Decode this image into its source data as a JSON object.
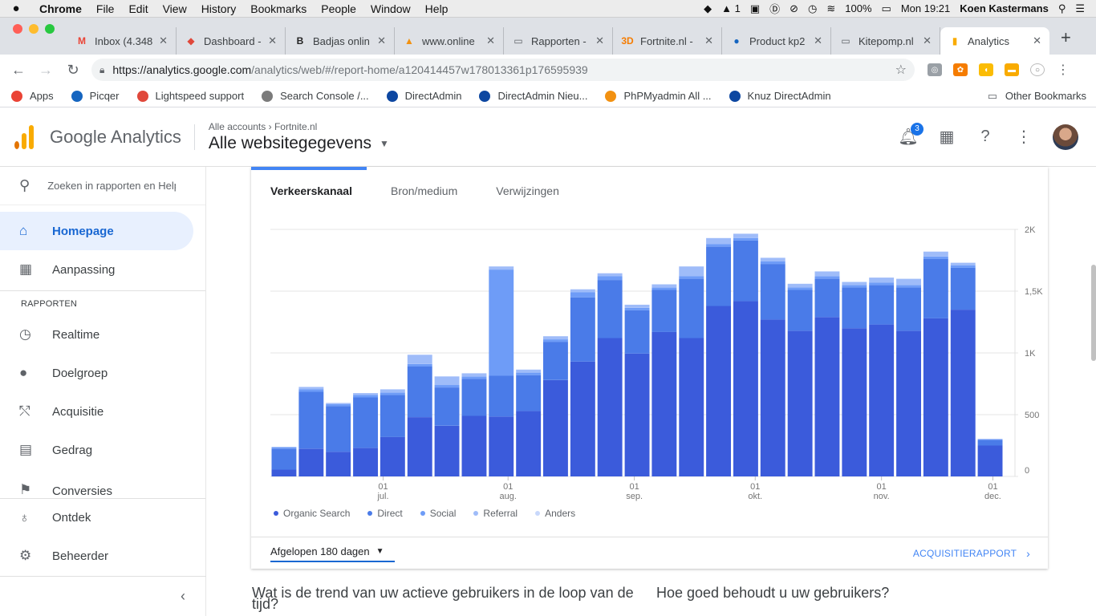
{
  "menubar": {
    "apple_icon": "apple-logo-icon",
    "app": "Chrome",
    "menus": [
      "File",
      "Edit",
      "View",
      "History",
      "Bookmarks",
      "People",
      "Window",
      "Help"
    ],
    "status_badge": "1",
    "battery": "100%",
    "clock": "Mon 19:21",
    "user": "Koen Kastermans"
  },
  "tabs": [
    {
      "label": "Inbox (4.348",
      "icon": "gmail-icon",
      "color": "#ea4335",
      "glyph": "M"
    },
    {
      "label": "Dashboard -",
      "icon": "lightspeed-icon",
      "color": "#e0483b",
      "glyph": "◆"
    },
    {
      "label": "Badjas onlin",
      "icon": "b-icon",
      "color": "#222222",
      "glyph": "B"
    },
    {
      "label": "www.online",
      "icon": "pma-icon",
      "color": "#f29111",
      "glyph": "▲"
    },
    {
      "label": "Rapporten -",
      "icon": "page-icon",
      "color": "#5f6368",
      "glyph": "▭"
    },
    {
      "label": "Fortnite.nl -",
      "icon": "fortnite-icon",
      "color": "#f57c00",
      "glyph": "3D"
    },
    {
      "label": "Product kp2",
      "icon": "picqer-icon",
      "color": "#1565c0",
      "glyph": "●"
    },
    {
      "label": "Kitepomp.nl",
      "icon": "page-icon",
      "color": "#5f6368",
      "glyph": "▭"
    },
    {
      "label": "Analytics",
      "icon": "analytics-icon",
      "color": "#f9ab00",
      "glyph": "▮"
    }
  ],
  "address": {
    "host": "https://analytics.google.com",
    "path": "/analytics/web/#/report-home/a120414457w178013361p176595939"
  },
  "bookmarks": [
    {
      "label": "Apps",
      "icon": "apps-grid-icon",
      "color": "#ea4335"
    },
    {
      "label": "Picqer",
      "icon": "picqer-icon",
      "color": "#1565c0"
    },
    {
      "label": "Lightspeed support",
      "icon": "lightspeed-icon",
      "color": "#e0483b"
    },
    {
      "label": "Search Console /...",
      "icon": "search-console-icon",
      "color": "#7b7b7b"
    },
    {
      "label": "DirectAdmin",
      "icon": "directadmin-icon",
      "color": "#0d47a1"
    },
    {
      "label": "DirectAdmin Nieu...",
      "icon": "directadmin-icon",
      "color": "#0d47a1"
    },
    {
      "label": "PhPMyadmin All ...",
      "icon": "pma-icon",
      "color": "#f29111"
    },
    {
      "label": "Knuz DirectAdmin",
      "icon": "directadmin-icon",
      "color": "#0d47a1"
    }
  ],
  "other_bookmarks": "Other Bookmarks",
  "ga": {
    "product": "Google Analytics",
    "crumb_accounts": "Alle accounts",
    "crumb_sep": "›",
    "crumb_property": "Fortnite.nl",
    "view": "Alle websitegegevens",
    "notifications": "3"
  },
  "sidebar": {
    "search_placeholder": "Zoeken in rapporten en Help",
    "section": "RAPPORTEN",
    "items": [
      {
        "label": "Homepage",
        "icon": "home-icon",
        "active": true
      },
      {
        "label": "Aanpassing",
        "icon": "customization-icon"
      },
      {
        "label": "Realtime",
        "icon": "clock-icon"
      },
      {
        "label": "Doelgroep",
        "icon": "person-icon"
      },
      {
        "label": "Acquisitie",
        "icon": "acquisition-icon"
      },
      {
        "label": "Gedrag",
        "icon": "behavior-icon"
      },
      {
        "label": "Conversies",
        "icon": "flag-icon"
      },
      {
        "label": "Ontdek",
        "icon": "lightbulb-icon"
      },
      {
        "label": "Beheerder",
        "icon": "gear-icon"
      }
    ]
  },
  "card": {
    "tabs": [
      "Verkeerskanaal",
      "Bron/medium",
      "Verwijzingen"
    ],
    "range": "Afgelopen 180 dagen",
    "link": "ACQUISITIERAPPORT"
  },
  "questions": [
    "Wat is de trend van uw actieve gebruikers in de loop van de tijd?",
    "Hoe goed behoudt u uw gebruikers?"
  ],
  "chart_data": {
    "type": "bar",
    "stacked": true,
    "ylim": [
      0,
      2000
    ],
    "yticks": [
      {
        "value": 2000,
        "label": "2K"
      },
      {
        "value": 1500,
        "label": "1,5K"
      },
      {
        "value": 1000,
        "label": "1K"
      },
      {
        "value": 500,
        "label": "500"
      },
      {
        "value": 0,
        "label": "0"
      }
    ],
    "xticks": [
      {
        "index": 4.15,
        "day": "01",
        "month": "jul."
      },
      {
        "index": 8.75,
        "day": "01",
        "month": "aug."
      },
      {
        "index": 13.4,
        "day": "01",
        "month": "sep."
      },
      {
        "index": 17.85,
        "day": "01",
        "month": "okt."
      },
      {
        "index": 22.5,
        "day": "01",
        "month": "nov."
      },
      {
        "index": 26.6,
        "day": "01",
        "month": "dec."
      }
    ],
    "series": [
      {
        "name": "Organic Search",
        "color": "#3b5bdb",
        "values": [
          55,
          225,
          200,
          230,
          320,
          480,
          410,
          490,
          485,
          530,
          780,
          930,
          1120,
          995,
          1170,
          1120,
          1380,
          1420,
          1270,
          1180,
          1290,
          1200,
          1230,
          1180,
          1280,
          1350,
          250
        ]
      },
      {
        "name": "Direct",
        "color": "#4a7be8",
        "values": [
          170,
          460,
          370,
          410,
          340,
          410,
          310,
          300,
          330,
          290,
          310,
          520,
          470,
          350,
          340,
          480,
          480,
          490,
          450,
          330,
          310,
          330,
          320,
          350,
          480,
          340,
          45
        ]
      },
      {
        "name": "Social",
        "color": "#6e9cf7",
        "values": [
          10,
          20,
          15,
          20,
          20,
          20,
          20,
          20,
          860,
          20,
          20,
          40,
          30,
          20,
          20,
          20,
          20,
          20,
          20,
          20,
          20,
          20,
          20,
          20,
          20,
          20,
          5
        ]
      },
      {
        "name": "Referral",
        "color": "#9fbcf9",
        "values": [
          5,
          20,
          10,
          15,
          25,
          75,
          70,
          25,
          25,
          25,
          25,
          25,
          25,
          25,
          25,
          80,
          50,
          35,
          30,
          30,
          40,
          25,
          40,
          50,
          40,
          20,
          5
        ]
      },
      {
        "name": "Anders",
        "color": "#c8d8fb",
        "values": [
          0,
          0,
          0,
          0,
          0,
          0,
          0,
          0,
          0,
          0,
          0,
          0,
          0,
          0,
          0,
          0,
          0,
          0,
          0,
          0,
          0,
          0,
          0,
          0,
          0,
          0,
          0
        ]
      }
    ]
  }
}
